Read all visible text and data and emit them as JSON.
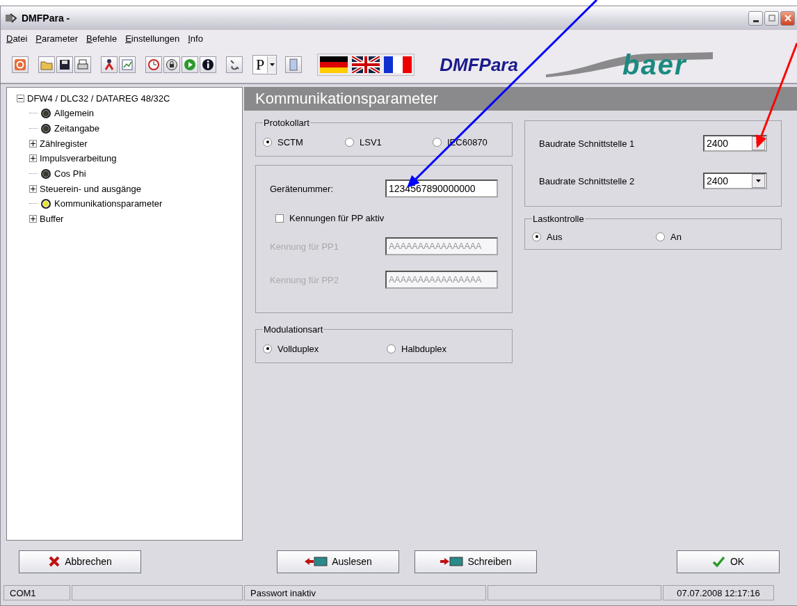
{
  "window": {
    "title": "DMFPara -"
  },
  "menu": [
    {
      "label": "Datei"
    },
    {
      "label": "Parameter"
    },
    {
      "label": "Befehle"
    },
    {
      "label": "Einstellungen"
    },
    {
      "label": "Info"
    }
  ],
  "toolbar": {
    "p_button": "P",
    "app_name": "DMFPara",
    "logo": "baer"
  },
  "tree": {
    "label": "DFW4 / DLC32 / DATAREG 48/32C",
    "kind": "folder",
    "expanded": true,
    "selected": false,
    "children": [
      {
        "label": "Allgemein",
        "kind": "leaf",
        "selected": false
      },
      {
        "label": "Zeitangabe",
        "kind": "leaf",
        "selected": false
      },
      {
        "label": "Zählregister",
        "kind": "folder",
        "expanded": false,
        "selected": false
      },
      {
        "label": "Impulsverarbeitung",
        "kind": "folder",
        "expanded": false,
        "selected": false
      },
      {
        "label": "Cos Phi",
        "kind": "leaf",
        "selected": false
      },
      {
        "label": "Steuerein- und ausgänge",
        "kind": "folder",
        "expanded": false,
        "selected": false
      },
      {
        "label": "Kommunikationsparameter",
        "kind": "leaf",
        "selected": true
      },
      {
        "label": "Buffer",
        "kind": "folder",
        "expanded": false,
        "selected": false
      }
    ]
  },
  "panel": {
    "title": "Kommunikationsparameter",
    "protokollart": {
      "legend": "Protokollart",
      "options": [
        {
          "label": "SCTM",
          "selected": true
        },
        {
          "label": "LSV1",
          "selected": false
        },
        {
          "label": "IEC60870",
          "selected": false
        }
      ]
    },
    "device": {
      "number_label": "Gerätenummer:",
      "number": "1234567890000000",
      "pp_checkbox": {
        "label": "Kennungen für PP aktiv",
        "checked": false
      },
      "pp_fields": [
        {
          "label": "Kennung für PP1",
          "value": "AAAAAAAAAAAAAAAA",
          "disabled": true
        },
        {
          "label": "Kennung für PP2",
          "value": "AAAAAAAAAAAAAAAA",
          "disabled": true
        }
      ]
    },
    "modulationsart": {
      "legend": "Modulationsart",
      "options": [
        {
          "label": "Vollduplex",
          "selected": true
        },
        {
          "label": "Halbduplex",
          "selected": false
        }
      ]
    },
    "baudrates": [
      {
        "label": "Baudrate Schnittstelle 1",
        "value": "2400"
      },
      {
        "label": "Baudrate Schnittstelle 2",
        "value": "2400"
      }
    ],
    "lastkontrolle": {
      "legend": "Lastkontrolle",
      "options": [
        {
          "label": "Aus",
          "selected": true
        },
        {
          "label": "An",
          "selected": false
        }
      ]
    }
  },
  "buttons": [
    {
      "label": "Abbrechen",
      "kind": "cancel"
    },
    {
      "label": "Auslesen",
      "kind": "read"
    },
    {
      "label": "Schreiben",
      "kind": "write"
    },
    {
      "label": "OK",
      "kind": "ok"
    }
  ],
  "status_bar": {
    "port": "COM1",
    "password": "Passwort inaktiv",
    "datetime": "07.07.2008 12:17:16"
  },
  "annotations": [
    {
      "color": "#0000ff"
    },
    {
      "color": "#ff0000"
    }
  ]
}
